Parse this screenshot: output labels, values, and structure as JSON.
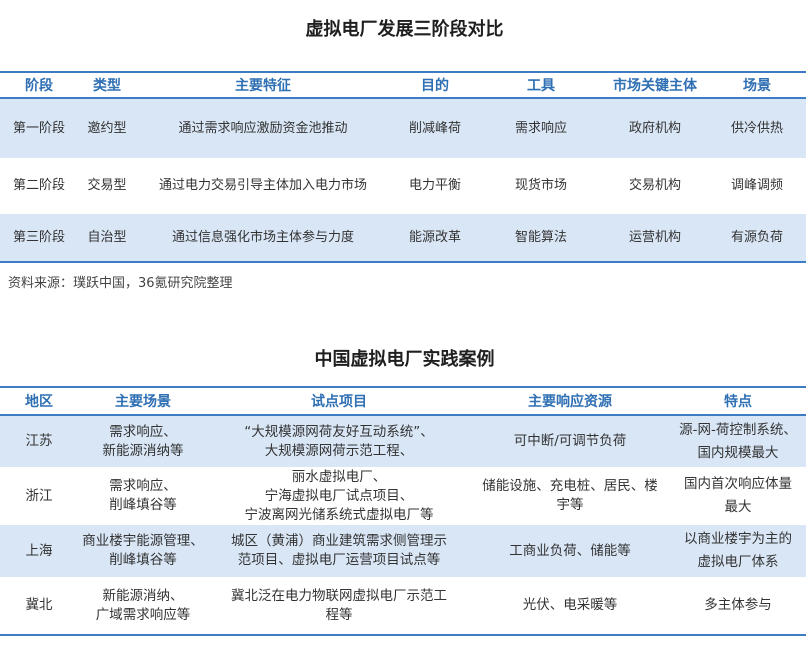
{
  "table1": {
    "title": "虚拟电厂发展三阶段对比",
    "headers": [
      "阶段",
      "类型",
      "主要特征",
      "目的",
      "工具",
      "市场关键主体",
      "场景"
    ],
    "rows": [
      [
        "第一阶段",
        "邀约型",
        "通过需求响应激励资金池推动",
        "削减峰荷",
        "需求响应",
        "政府机构",
        "供冷供热"
      ],
      [
        "第二阶段",
        "交易型",
        "通过电力交易引导主体加入电力市场",
        "电力平衡",
        "现货市场",
        "交易机构",
        "调峰调频"
      ],
      [
        "第三阶段",
        "自治型",
        "通过信息强化市场主体参与力度",
        "能源改革",
        "智能算法",
        "运营机构",
        "有源负荷"
      ]
    ],
    "source": "资料来源：璞跃中国，36氪研究院整理"
  },
  "table2": {
    "title": "中国虚拟电厂实践案例",
    "headers": [
      "地区",
      "主要场景",
      "试点项目",
      "主要响应资源",
      "特点"
    ],
    "rows": [
      {
        "region": "江苏",
        "scene": [
          "需求响应、",
          "新能源消纳等"
        ],
        "project": [
          "“大规模源网荷友好互动系统”、",
          "大规模源网荷示范工程、"
        ],
        "resource": [
          "可中断/可调节负荷"
        ],
        "feature": [
          "源-网-荷控制系统、",
          "国内规模最大"
        ]
      },
      {
        "region": "浙江",
        "scene": [
          "需求响应、",
          "削峰填谷等"
        ],
        "project": [
          "丽水虚拟电厂、",
          "宁海虚拟电厂试点项目、",
          "宁波离网光储系统式虚拟电厂等"
        ],
        "resource": [
          "储能设施、充电桩、居民、楼",
          "宇等"
        ],
        "feature": [
          "国内首次响应体量",
          "最大"
        ]
      },
      {
        "region": "上海",
        "scene": [
          "商业楼宇能源管理、",
          "削峰填谷等"
        ],
        "project": [
          "城区（黄浦）商业建筑需求侧管理示",
          "范项目、虚拟电厂运营项目试点等"
        ],
        "resource": [
          "工商业负荷、储能等"
        ],
        "feature": [
          "以商业楼宇为主的",
          "虚拟电厂体系"
        ]
      },
      {
        "region": "冀北",
        "scene": [
          "新能源消纳、",
          "广域需求响应等"
        ],
        "project": [
          "冀北泛在电力物联网虚拟电厂示范工",
          "程等"
        ],
        "resource": [
          "光伏、电采暖等"
        ],
        "feature": [
          "多主体参与"
        ]
      }
    ]
  },
  "colors": {
    "accent": "#3d7cc4",
    "header_text": "#2f6fb3",
    "row_fill": "#d9e6f6"
  }
}
